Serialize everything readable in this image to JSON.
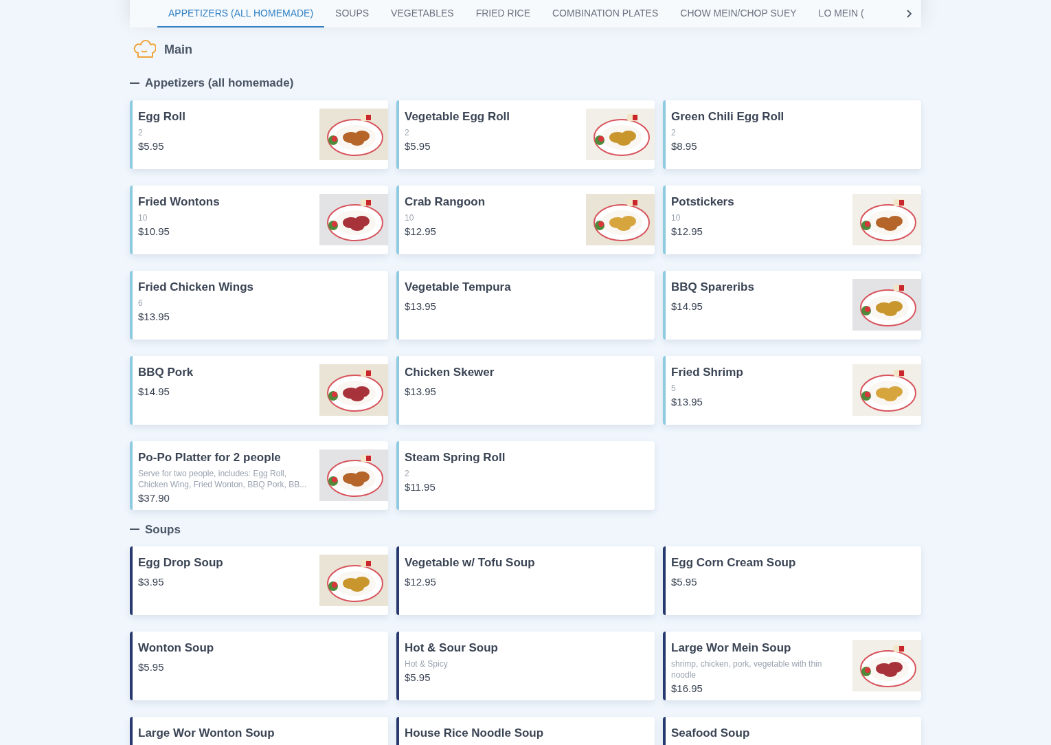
{
  "tabs": [
    {
      "label": "APPETIZERS (ALL HOMEMADE)",
      "selected": true
    },
    {
      "label": "SOUPS",
      "selected": false
    },
    {
      "label": "VEGETABLES",
      "selected": false
    },
    {
      "label": "FRIED RICE",
      "selected": false
    },
    {
      "label": "COMBINATION PLATES",
      "selected": false
    },
    {
      "label": "CHOW MEIN/CHOP SUEY",
      "selected": false
    },
    {
      "label": "LO MEIN (",
      "selected": false
    }
  ],
  "menu_title": "Main",
  "sections": [
    {
      "title": "Appetizers (all homemade)",
      "color": "#8ecae0",
      "items": [
        {
          "name": "Egg Roll",
          "note": "2",
          "price": "$5.95"
        },
        {
          "name": "Vegetable Egg Roll",
          "note": "2",
          "price": "$5.95"
        },
        {
          "name": "Green Chili Egg Roll",
          "note": "2",
          "price": "$8.95"
        },
        {
          "name": "Fried Wontons",
          "note": "10",
          "price": "$10.95"
        },
        {
          "name": "Crab Rangoon",
          "note": "10",
          "price": "$12.95"
        },
        {
          "name": "Potstickers",
          "note": "10",
          "price": "$12.95"
        },
        {
          "name": "Fried Chicken Wings",
          "note": "6",
          "price": "$13.95"
        },
        {
          "name": "Vegetable Tempura",
          "price": "$13.95"
        },
        {
          "name": "BBQ Spareribs",
          "price": "$14.95"
        },
        {
          "name": "BBQ Pork",
          "price": "$14.95"
        },
        {
          "name": "Chicken Skewer",
          "price": "$13.95"
        },
        {
          "name": "Fried Shrimp",
          "note": "5",
          "price": "$13.95"
        },
        {
          "name": "Po-Po Platter for 2 people",
          "note": "Serve for two people, includes: Egg Roll, Chicken Wing, Fried Wonton, BBQ Pork, BB...",
          "price": "$37.90"
        },
        {
          "name": "Steam Spring Roll",
          "note": "2",
          "price": "$11.95"
        }
      ]
    },
    {
      "title": "Soups",
      "color": "#27396f",
      "items": [
        {
          "name": "Egg Drop Soup",
          "price": "$3.95"
        },
        {
          "name": "Vegetable w/ Tofu Soup",
          "price": "$12.95"
        },
        {
          "name": "Egg Corn Cream Soup",
          "price": "$5.95"
        },
        {
          "name": "Wonton Soup",
          "price": "$5.95"
        },
        {
          "name": "Hot & Sour Soup",
          "note": "Hot & Spicy",
          "price": "$5.95"
        },
        {
          "name": "Large Wor Mein Soup",
          "note": "shrimp, chicken, pork, vegetable with thin noodle",
          "price": "$16.95"
        },
        {
          "name": "Large Wor Wonton Soup"
        },
        {
          "name": "House Rice Noodle Soup"
        },
        {
          "name": "Seafood Soup"
        }
      ]
    }
  ]
}
